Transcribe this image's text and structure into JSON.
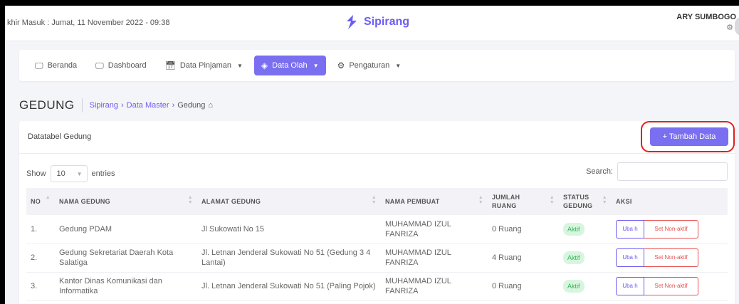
{
  "header": {
    "last_login": "khir Masuk : Jumat, 11 November 2022 - 09:38",
    "brand": "Sipirang",
    "user_name": "ARY SUMBOGO",
    "user_icon": "gear-icon"
  },
  "nav": {
    "items": [
      {
        "label": "Beranda",
        "icon": "monitor-icon"
      },
      {
        "label": "Dashboard",
        "icon": "monitor-icon"
      },
      {
        "label": "Data Pinjaman",
        "icon": "calendar-icon",
        "dropdown": true
      },
      {
        "label": "Data Olah",
        "icon": "layers-icon",
        "dropdown": true,
        "active": true
      },
      {
        "label": "Pengaturan",
        "icon": "gear-icon",
        "dropdown": true
      }
    ]
  },
  "page": {
    "title": "GEDUNG",
    "breadcrumb": [
      "Sipirang",
      "Data Master",
      "Gedung"
    ]
  },
  "card": {
    "title": "Datatabel Gedung",
    "add_button": "+ Tambah Data"
  },
  "controls": {
    "show_label": "Show",
    "length_value": "10",
    "entries_label": "entries",
    "search_label": "Search:"
  },
  "table": {
    "headers": [
      "NO",
      "NAMA GEDUNG",
      "ALAMAT GEDUNG",
      "NAMA PEMBUAT",
      "JUMLAH RUANG",
      "STATUS GEDUNG",
      "AKSI"
    ],
    "rows": [
      {
        "no": "1.",
        "nama": "Gedung PDAM",
        "alamat": "Jl Sukowati No 15",
        "pembuat": "MUHAMMAD IZUL FANRIZA",
        "jumlah": "0 Ruang",
        "status": "Aktif"
      },
      {
        "no": "2.",
        "nama": "Gedung Sekretariat Daerah Kota Salatiga",
        "alamat": "Jl. Letnan Jenderal Sukowati No 51 (Gedung 3 4 Lantai)",
        "pembuat": "MUHAMMAD IZUL FANRIZA",
        "jumlah": "4 Ruang",
        "status": "Aktif"
      },
      {
        "no": "3.",
        "nama": "Kantor Dinas Komunikasi dan Informatika",
        "alamat": "Jl. Letnan Jenderal Sukowati No 51 (Paling Pojok)",
        "pembuat": "MUHAMMAD IZUL FANRIZA",
        "jumlah": "0 Ruang",
        "status": "Aktif"
      }
    ],
    "edit_label": "Uba h",
    "deactivate_label": "Set Non-aktif"
  },
  "colors": {
    "accent": "#7a6ff0",
    "highlight_border": "#e0201c",
    "active_badge_bg": "#d8f6df",
    "active_badge_text": "#34b255",
    "danger": "#e65050"
  }
}
